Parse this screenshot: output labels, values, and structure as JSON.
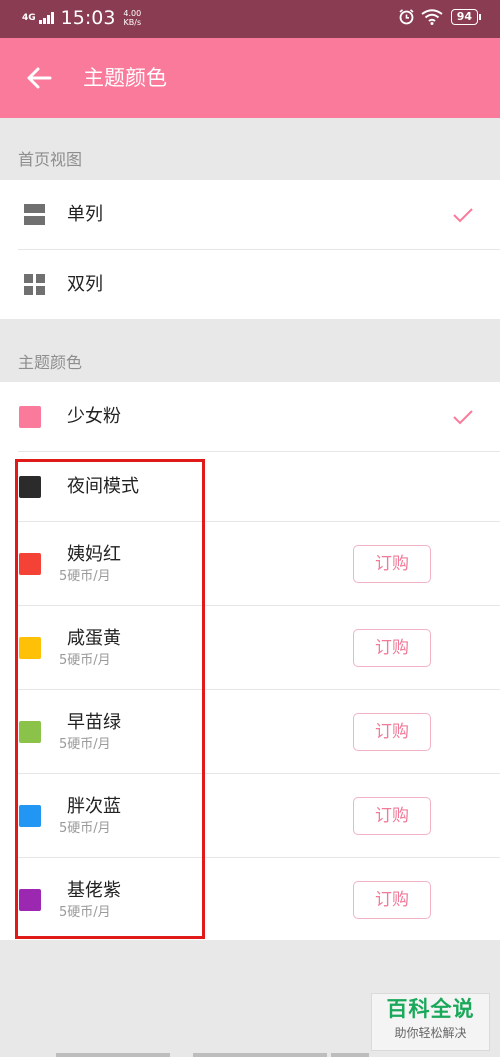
{
  "status_bar": {
    "network": "4G",
    "time": "15:03",
    "speed_value": "4.00",
    "speed_unit": "KB/s",
    "battery": "94"
  },
  "app_bar": {
    "title": "主题颜色",
    "back_icon": "arrow-left-icon"
  },
  "sections": {
    "home_view": {
      "header": "首页视图",
      "items": [
        {
          "label": "单列",
          "icon": "list-view-icon",
          "selected": true
        },
        {
          "label": "双列",
          "icon": "grid-view-icon",
          "selected": false
        }
      ]
    },
    "theme_color": {
      "header": "主题颜色",
      "items": [
        {
          "label": "少女粉",
          "color": "#fa7a9b",
          "selected": true
        },
        {
          "label": "夜间模式",
          "color": "#2b2b2b",
          "selected": false
        },
        {
          "label": "姨妈红",
          "price": "5硬币/月",
          "button": "订购",
          "color": "#f44336"
        },
        {
          "label": "咸蛋黄",
          "price": "5硬币/月",
          "button": "订购",
          "color": "#ffc107"
        },
        {
          "label": "早苗绿",
          "price": "5硬币/月",
          "button": "订购",
          "color": "#8bc34a"
        },
        {
          "label": "胖次蓝",
          "price": "5硬币/月",
          "button": "订购",
          "color": "#2196f3"
        },
        {
          "label": "基佬紫",
          "price": "5硬币/月",
          "button": "订购",
          "color": "#9c27b0"
        }
      ]
    }
  },
  "watermark": {
    "title": "百科全说",
    "subtitle": "助你轻松解决"
  },
  "colors": {
    "accent": "#fa7a9b",
    "status_bar": "#8a3d52",
    "highlight_box": "#e01919"
  }
}
